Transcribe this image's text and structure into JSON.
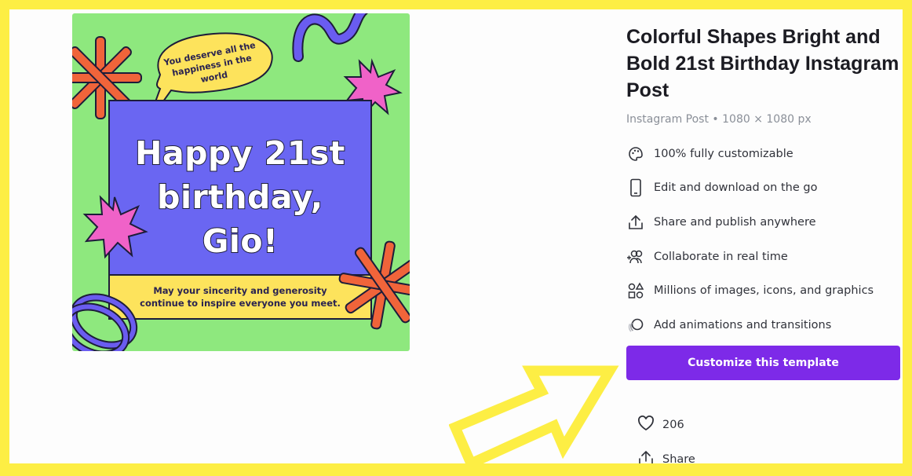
{
  "preview": {
    "bubble_text": "You deserve all the happiness in the world",
    "headline_line1": "Happy 21st",
    "headline_line2": "birthday,",
    "headline_line3": "Gio!",
    "message": "May your sincerity and generosity continue to inspire everyone you meet."
  },
  "template": {
    "title": "Colorful Shapes Bright and Bold 21st Birthday Instagram Post",
    "subtitle": "Instagram Post • 1080 × 1080 px"
  },
  "features": [
    {
      "icon": "palette-icon",
      "label": "100% fully customizable"
    },
    {
      "icon": "phone-icon",
      "label": "Edit and download on the go"
    },
    {
      "icon": "upload-icon",
      "label": "Share and publish anywhere"
    },
    {
      "icon": "collaborate-icon",
      "label": "Collaborate in real time"
    },
    {
      "icon": "shapes-icon",
      "label": "Millions of images, icons, and graphics"
    },
    {
      "icon": "animation-icon",
      "label": "Add animations and transitions"
    }
  ],
  "cta": {
    "label": "Customize this template"
  },
  "social": {
    "likes": "206",
    "share_label": "Share"
  },
  "colors": {
    "frame": "#fdee44",
    "cta": "#7d2ae8",
    "preview_bg": "#8ee87e",
    "card_blue": "#6a66f2",
    "card_yellow": "#fde35c"
  }
}
